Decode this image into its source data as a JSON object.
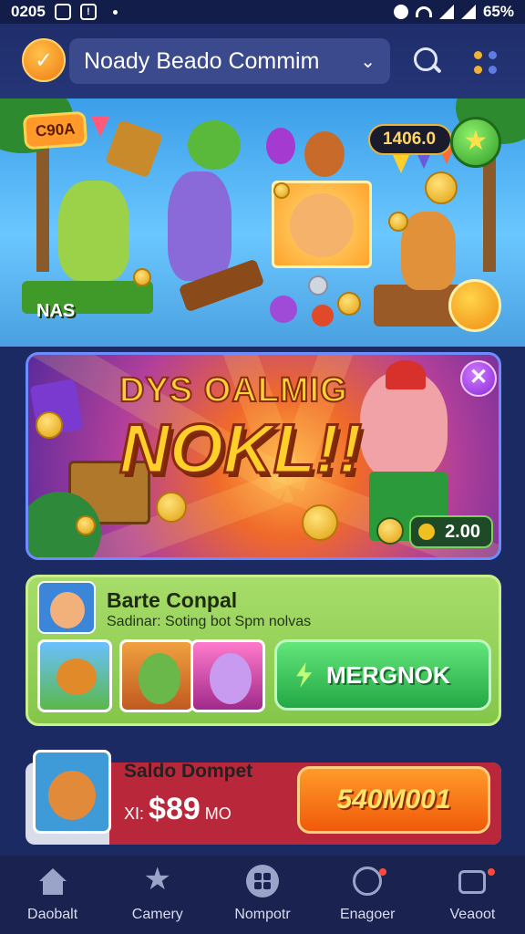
{
  "status_bar": {
    "time": "0205",
    "battery": "65%"
  },
  "header": {
    "title": "Noady Beado Commim",
    "title_icon": "chevron-down-icon"
  },
  "hero": {
    "badge": "C90A",
    "score": "1406.0",
    "side_label": "NAS"
  },
  "banner": {
    "title_line1": "DYS OALMIG",
    "title_line2": "NOKL!!",
    "amount": "2.00"
  },
  "quest": {
    "title": "Barte Conpal",
    "subtitle": "Sadinar: Soting bot Spm nolvas",
    "cta_label": "MERGNOK"
  },
  "wallet": {
    "title": "Saldo Dompet",
    "prefix": "XI:",
    "amount": "$89",
    "suffix": "MO",
    "button_label": "540M001"
  },
  "nav": {
    "items": [
      {
        "label": "Daobalt",
        "icon": "home-icon"
      },
      {
        "label": "Camery",
        "icon": "star-icon"
      },
      {
        "label": "Nompotr",
        "icon": "grid-icon"
      },
      {
        "label": "Enagoer",
        "icon": "gauge-icon"
      },
      {
        "label": "Veaoot",
        "icon": "bag-icon"
      }
    ]
  },
  "colors": {
    "header_bg": "#1f2d6b",
    "accent_orange": "#f07a12",
    "quest_green": "#84c64a",
    "cta_green": "#22a845",
    "wallet_red": "#b8283a"
  }
}
